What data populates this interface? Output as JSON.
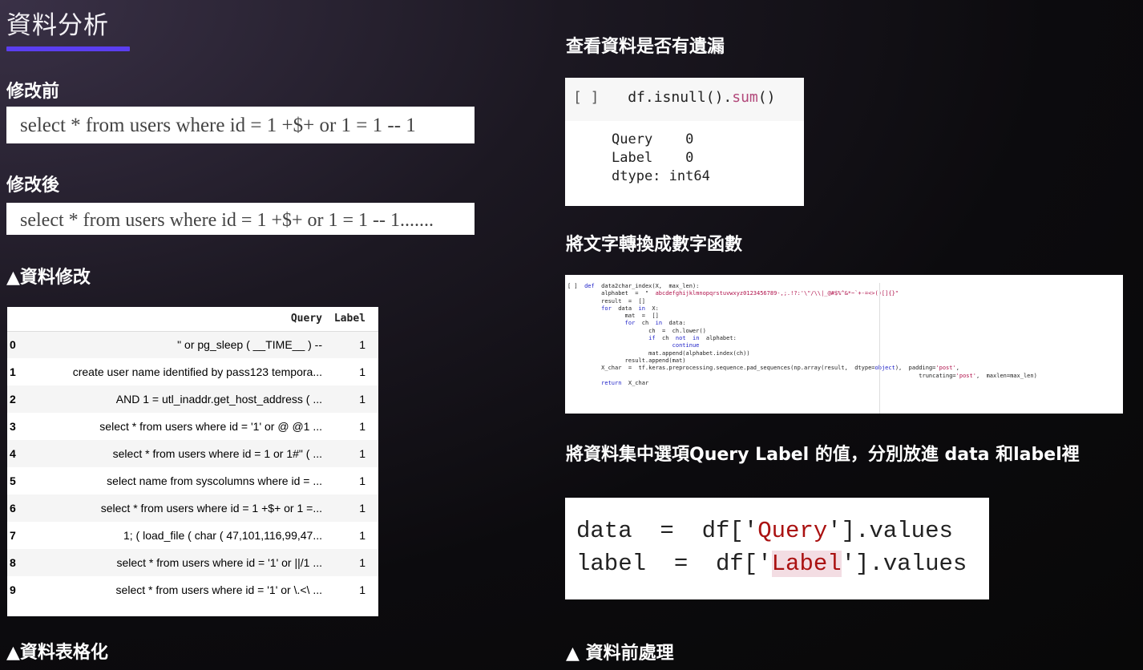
{
  "left": {
    "title": "資料分析",
    "before_label": "修改前",
    "before_code": "select * from users where id  =  1 +$+ or 1  =  1 -- 1",
    "after_label": "修改後",
    "after_code": "select * from users where id  =  1 +$+ or 1  =  1 -- 1.......",
    "caption_modify": "▲資料修改",
    "caption_table": "▲資料表格化",
    "table": {
      "headers": [
        "",
        "Query",
        "Label"
      ],
      "rows": [
        {
          "idx": "0",
          "query": "\" or pg_sleep ( __TIME__ ) --",
          "label": "1"
        },
        {
          "idx": "1",
          "query": "create user name identified by pass123 tempora...",
          "label": "1"
        },
        {
          "idx": "2",
          "query": "AND 1 = utl_inaddr.get_host_address ( ...",
          "label": "1"
        },
        {
          "idx": "3",
          "query": "select * from users where id = '1' or @ @1 ...",
          "label": "1"
        },
        {
          "idx": "4",
          "query": "select * from users where id = 1 or 1#\" ( ...",
          "label": "1"
        },
        {
          "idx": "5",
          "query": "select name from syscolumns where id = ...",
          "label": "1"
        },
        {
          "idx": "6",
          "query": "select * from users where id = 1 +$+ or 1 =...",
          "label": "1"
        },
        {
          "idx": "7",
          "query": "1; ( load_file ( char ( 47,101,116,99,47...",
          "label": "1"
        },
        {
          "idx": "8",
          "query": "select * from users where id = '1' or ||/1 ...",
          "label": "1"
        },
        {
          "idx": "9",
          "query": "select * from users where id = '1' or \\.<\\ ...",
          "label": "1"
        }
      ]
    }
  },
  "right": {
    "heading_missing": "查看資料是否有遺漏",
    "null_cell_prompt": "[ ]",
    "null_cell_code_prefix": "df.isnull().",
    "null_cell_code_fn": "sum",
    "null_cell_code_suffix": "()",
    "null_output": "Query    0\nLabel    0\ndtype: int64",
    "heading_convert": "將文字轉換成數字函數",
    "heading_split": "將資料集中選項Query Label 的值，分別放進 data 和label裡",
    "code_data_line_a": "data  =  df['",
    "code_data_str": "Query",
    "code_data_line_b": "'].values",
    "code_label_line_a": "label  =  df['",
    "code_label_str": "Label",
    "code_label_line_b": "'].values",
    "caption_preprocess": "▲ 資料前處理"
  }
}
